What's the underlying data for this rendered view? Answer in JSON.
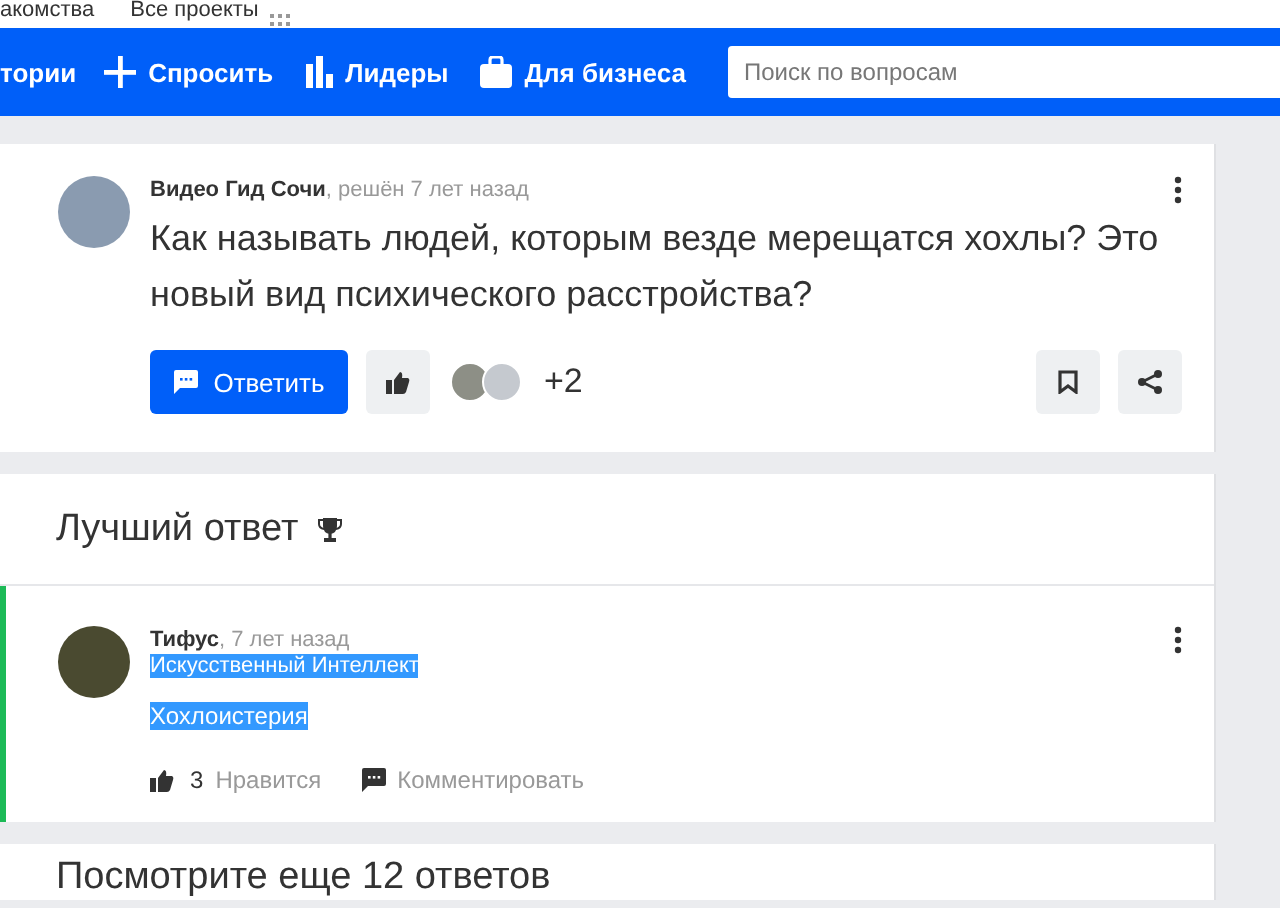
{
  "top_links": [
    "акомства",
    "Все проекты"
  ],
  "nav": {
    "items": [
      {
        "kind": "text",
        "label": "тории"
      },
      {
        "kind": "plus",
        "label": "Спросить"
      },
      {
        "kind": "chart",
        "label": "Лидеры"
      },
      {
        "kind": "bag",
        "label": "Для бизнеса"
      }
    ],
    "search": {
      "placeholder": "Поиск по вопросам"
    }
  },
  "question": {
    "author": "Видео Гид Сочи",
    "meta": ", решён 7 лет назад",
    "text": "Как называть людей, которым везде мерещатся хохлы? Это новый вид психического расстройства?",
    "reply_button": "Ответить",
    "likers_more": "+2"
  },
  "best_answer": {
    "title": "Лучший ответ",
    "author": "Тифус",
    "meta": ", 7 лет назад",
    "rank": {
      "text": "Искусственный Интеллект",
      "highlighted": true
    },
    "body": {
      "text": "Хохлоистерия",
      "highlighted": true
    },
    "likes": "3",
    "like_label": "Нравится",
    "comment_label": "Комментировать"
  },
  "more_answers": "Посмотрите еще 12 ответов"
}
